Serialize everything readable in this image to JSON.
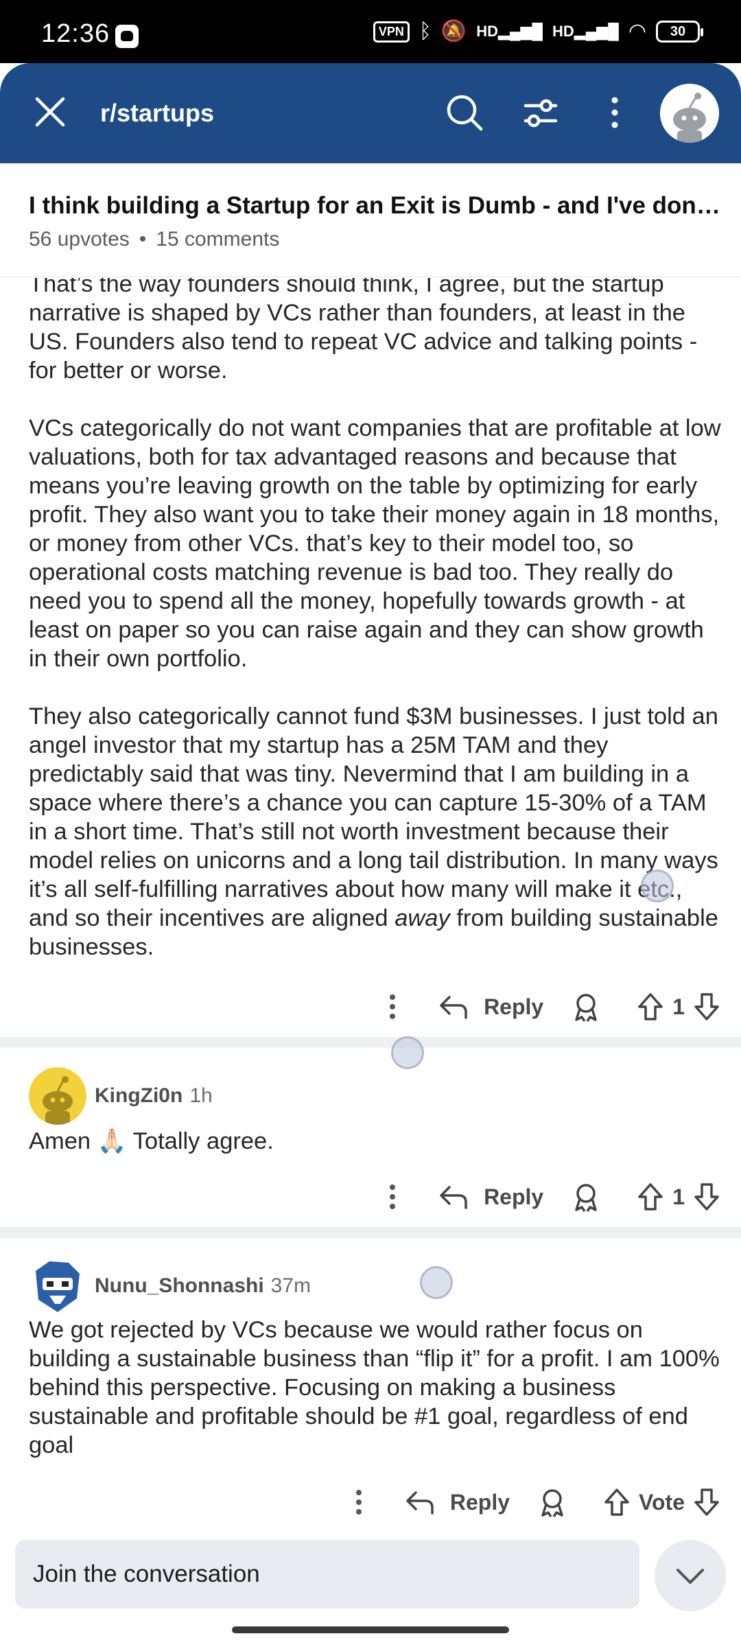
{
  "status_bar": {
    "time": "12:36",
    "vpn": "VPN",
    "battery": "30",
    "signal1": "HD",
    "signal2": "HD"
  },
  "toolbar": {
    "subreddit": "r/startups",
    "icons": [
      "close-icon",
      "search-icon",
      "filter-icon",
      "more-vertical-icon",
      "avatar"
    ]
  },
  "post": {
    "title": "I think building a Startup for an Exit is Dumb - and I've done ...",
    "upvotes": "56 upvotes",
    "separator": "•",
    "comments": "15 comments"
  },
  "comment_1": {
    "paragraphs": [
      "That’s the way founders should think, I agree, but the startup narrative is shaped by VCs rather than founders, at least in the US. Founders also tend to repeat VC advice and talking points - for better or worse.",
      "VCs categorically do not want companies that are profitable at low valuations, both for tax advantaged reasons and because that means you’re leaving growth on the table by optimizing for early profit. They also want you to take their money again in 18 months, or money from other VCs. that’s key to their model too, so operational costs matching revenue is bad too. They really do need you to spend all the money, hopefully towards growth - at least on paper so you can raise again and they can show growth in their own portfolio.",
      "They also categorically cannot fund $3M businesses. I just told an angel investor that my startup has a 25M TAM and they predictably said that was tiny. Nevermind that I am building in a space where there’s a chance you can capture 15-30% of a TAM in a short time. That’s still not worth investment because their model relies on unicorns and a long tail distribution. In many ways it’s all self-fulfilling narratives about how many will make it etc., and so their incentives are aligned"
    ],
    "emph": "away",
    "tail": " from building sustainable businesses.",
    "reply_label": "Reply",
    "votes": "1"
  },
  "comment_2": {
    "username": "KingZi0n",
    "time": "1h",
    "text": "Amen 🙏🏻 Totally agree.",
    "reply_label": "Reply",
    "votes": "1"
  },
  "comment_3": {
    "username": "Nunu_Shonnashi",
    "time": "37m",
    "text": "We got rejected by VCs because we would rather focus on building a sustainable business than “flip it” for a profit. I am 100% behind this perspective. Focusing on making a business sustainable and profitable should be #1 goal, regardless of end goal",
    "reply_label": "Reply",
    "votes": "Vote"
  },
  "composer": {
    "placeholder": "Join the conversation"
  },
  "colors": {
    "toolbar": "#1e4b85",
    "separator": "#eef1f4",
    "input_bg": "#e8ecf0"
  }
}
